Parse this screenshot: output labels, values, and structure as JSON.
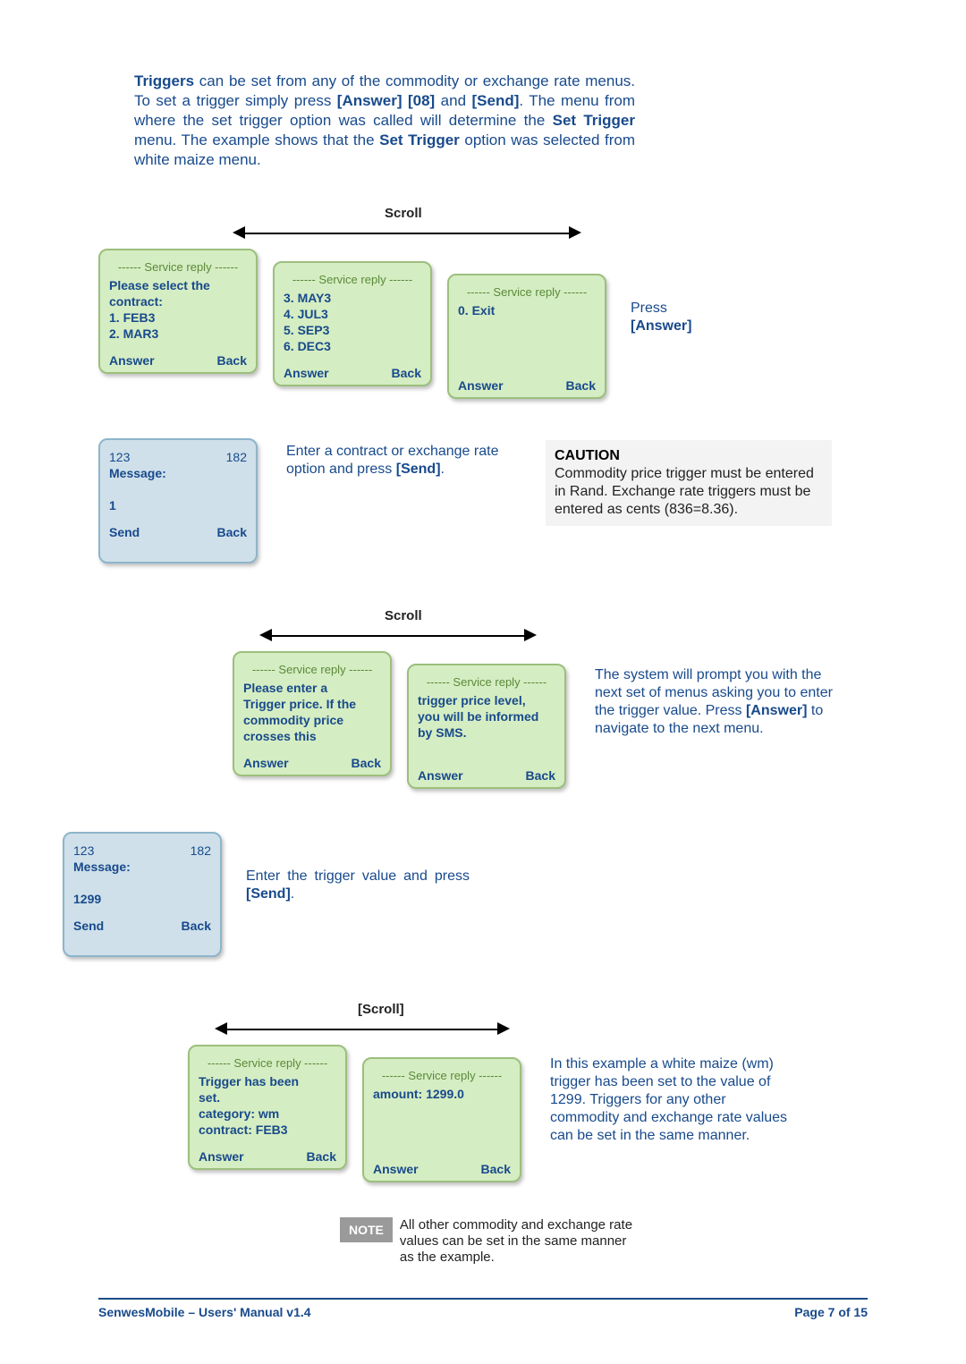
{
  "intro": {
    "word_triggers": "Triggers",
    "t1": " can be set from any of the commodity or exchange rate menus. To set a trigger simply press ",
    "answer08": "[Answer] [08]",
    "and": " and ",
    "send": "[Send]",
    "t2": ". The menu from where the set trigger option was called will determine the ",
    "settrigger": "Set Trigger",
    "t3": " menu. The example shows that the ",
    "settrigger2": "Set Trigger",
    "t4": " option was selected from white maize menu."
  },
  "labels": {
    "scroll": "Scroll",
    "scroll_br": "[Scroll]",
    "service_reply": "------ Service reply ------",
    "answer": "Answer",
    "back": "Back",
    "send": "Send"
  },
  "row1": {
    "box1_l1": "Please select the",
    "box1_l2": "contract:",
    "box1_l3": "1. FEB3",
    "box1_l4": "2. MAR3",
    "box2_l1": "3. MAY3",
    "box2_l2": "4. JUL3",
    "box2_l3": "5. SEP3",
    "box2_l4": "6. DEC3",
    "box3_l1": "0. Exit",
    "side1": "Press",
    "side2": "[Answer]"
  },
  "row2": {
    "bluebox_top_l": "123",
    "bluebox_top_r": "182",
    "bluebox_msg": "Message:",
    "bluebox_val": "1",
    "inst_a": "Enter a contract or exchange rate option and press ",
    "inst_b": "[Send]",
    "inst_c": ".",
    "caution_h": "CAUTION",
    "caution_t": "Commodity price trigger must be entered in Rand. Exchange rate triggers must be entered as cents (836=8.36)."
  },
  "row3": {
    "box1_l1": "Please enter a",
    "box1_l2": "Trigger price. If the",
    "box1_l3": "commodity price",
    "box1_l4": "crosses this",
    "box2_l1": "trigger price level,",
    "box2_l2": "you will be informed",
    "box2_l3": "by SMS.",
    "side_a": "The system will prompt you with the next set of menus asking you to enter the trigger value. Press ",
    "side_b": "[Answer]",
    "side_c": " to navigate to the next menu."
  },
  "row4": {
    "bluebox_top_l": "123",
    "bluebox_top_r": "182",
    "bluebox_msg": "Message:",
    "bluebox_val": "1299",
    "inst_a": "Enter the trigger value and press ",
    "inst_b": "[Send]",
    "inst_c": "."
  },
  "row5": {
    "box1_l1": "Trigger has been",
    "box1_l2": "set.",
    "box1_l3": "category: wm",
    "box1_l4": "contract: FEB3",
    "box2_l1": "amount: 1299.0",
    "side": "In this example a white maize (wm) trigger has  been set to the value of 1299. Triggers for any other commodity and exchange rate values can be set in the same manner."
  },
  "note": {
    "label": "NOTE",
    "text": "All other commodity and exchange rate values can be set in the same manner as the example."
  },
  "footer": {
    "left": "SenwesMobile – Users' Manual v1.4",
    "right": "Page 7 of 15"
  }
}
